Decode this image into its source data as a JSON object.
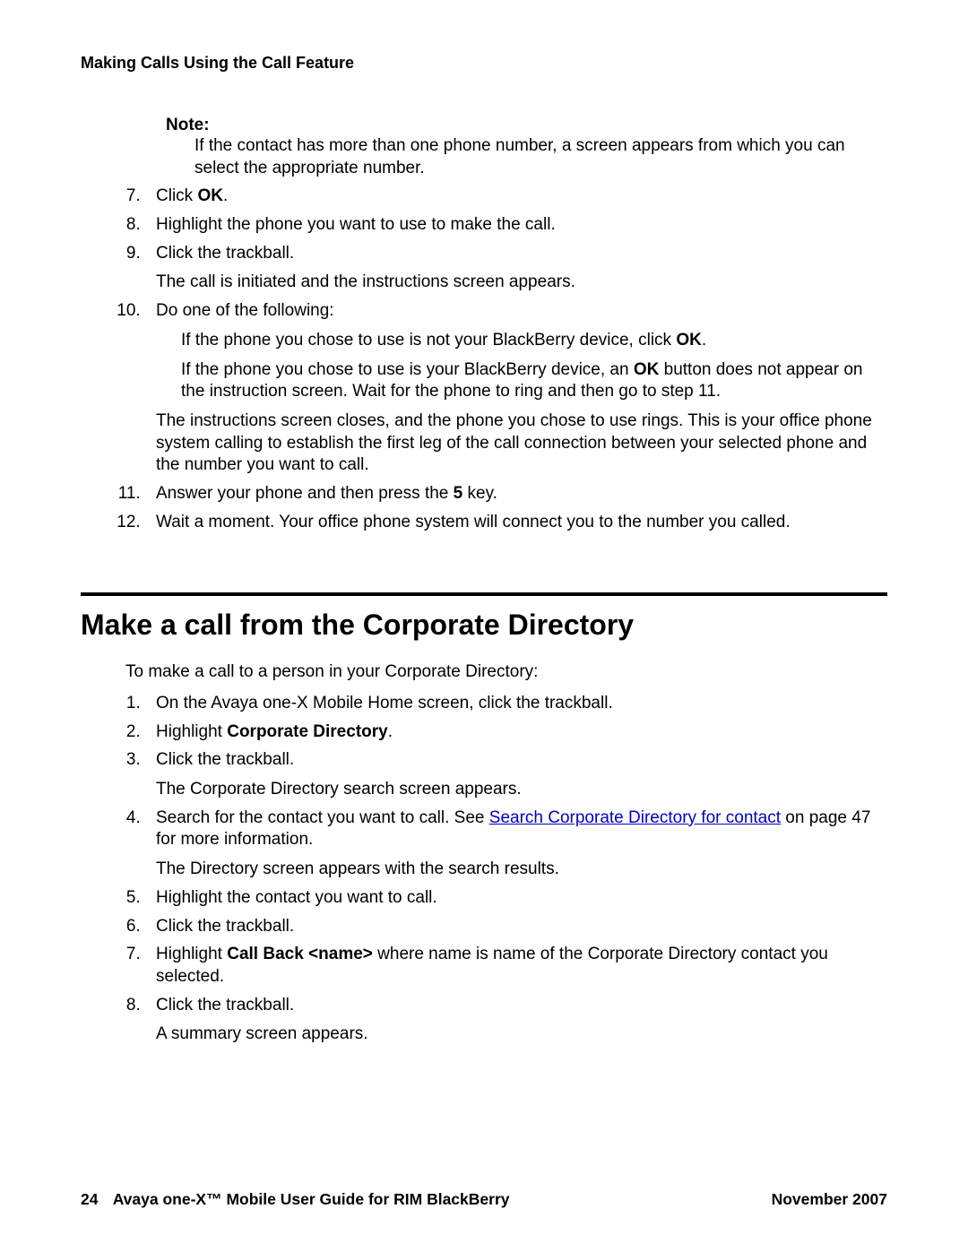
{
  "header": {
    "running": "Making Calls Using the Call Feature"
  },
  "note": {
    "label": "Note:",
    "body": "If the contact has more than one phone number, a screen appears from which you can select the appropriate number."
  },
  "steps1": {
    "s7_pre": "Click ",
    "s7_bold": "OK",
    "s7_post": ".",
    "s8": "Highlight the phone you want to use to make the call.",
    "s9": "Click the trackball.",
    "s9_p": "The call is initiated and the instructions screen appears.",
    "s10": "Do one of the following:",
    "s10_a_pre": "If the phone you chose to use is not your BlackBerry device, click ",
    "s10_a_bold": "OK",
    "s10_a_post": ".",
    "s10_b_pre": "If the phone you chose to use is your BlackBerry device, an ",
    "s10_b_bold": "OK",
    "s10_b_post": " button does not appear on the instruction screen. Wait for the phone to ring and then go to step 11.",
    "s10_p": "The instructions screen closes, and the phone you chose to use rings. This is your office phone system calling to establish the first leg of the call connection between your selected phone and the number you want to call.",
    "s11_pre": "Answer your phone and then press the ",
    "s11_bold": "5",
    "s11_post": " key.",
    "s12": "Wait a moment. Your office phone system will connect you to the number you called."
  },
  "section": {
    "heading": "Make a call from the Corporate Directory",
    "intro": "To make a call to a person in your Corporate Directory:"
  },
  "steps2": {
    "s1": "On the Avaya one-X Mobile Home screen, click the trackball.",
    "s2_pre": "Highlight ",
    "s2_bold": "Corporate Directory",
    "s2_post": ".",
    "s3": "Click the trackball.",
    "s3_p": "The Corporate Directory search screen appears.",
    "s4_pre": "Search for the contact you want to call. See ",
    "s4_link": "Search Corporate Directory for contact",
    "s4_post": " on page 47 for more information.",
    "s4_p": "The Directory screen appears with the search results.",
    "s5": "Highlight the contact you want to call.",
    "s6": "Click the trackball.",
    "s7_pre": "Highlight ",
    "s7_bold": "Call Back <name>",
    "s7_post": " where name is name of the Corporate Directory contact you selected.",
    "s8": "Click the trackball.",
    "s8_p": "A summary screen appears."
  },
  "footer": {
    "page": "24",
    "title": "Avaya one-X™ Mobile User Guide for RIM BlackBerry",
    "date": "November 2007"
  }
}
